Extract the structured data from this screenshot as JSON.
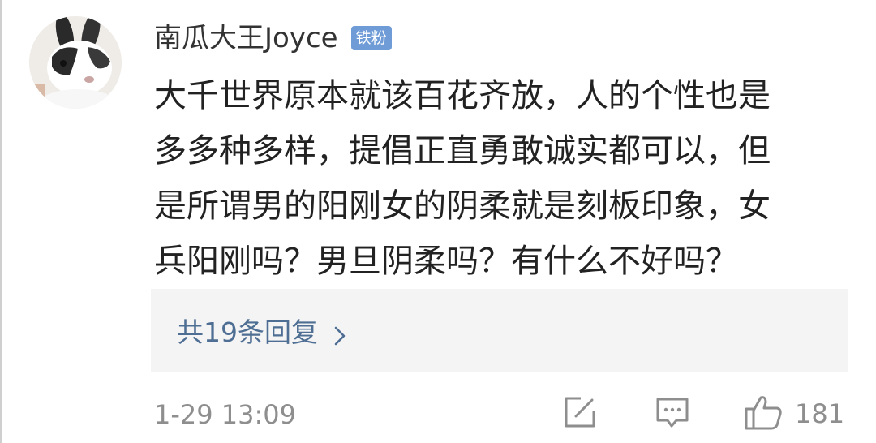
{
  "comment": {
    "username": "南瓜大王Joyce",
    "badge": "铁粉",
    "text_lines": [
      "大千世界原本就该百花齐放，人的个性也是",
      "多多种多样，提倡正直勇敢诚实都可以，但",
      "是所谓男的阳刚女的阴柔就是刻板印象，女",
      "兵阳刚吗？男旦阴柔吗？有什么不好吗？"
    ],
    "replies_label": "共19条回复",
    "timestamp": "1-29 13:09",
    "like_count": "181"
  },
  "icons": {
    "edit": "edit-icon",
    "comment": "comment-icon",
    "like": "thumbs-up-icon",
    "chevron": "chevron-right-icon"
  },
  "colors": {
    "text": "#222222",
    "meta": "#8e8e8e",
    "link": "#4e6e93",
    "badge": "#6f9bd6",
    "reply_box_bg": "#f4f4f5"
  }
}
